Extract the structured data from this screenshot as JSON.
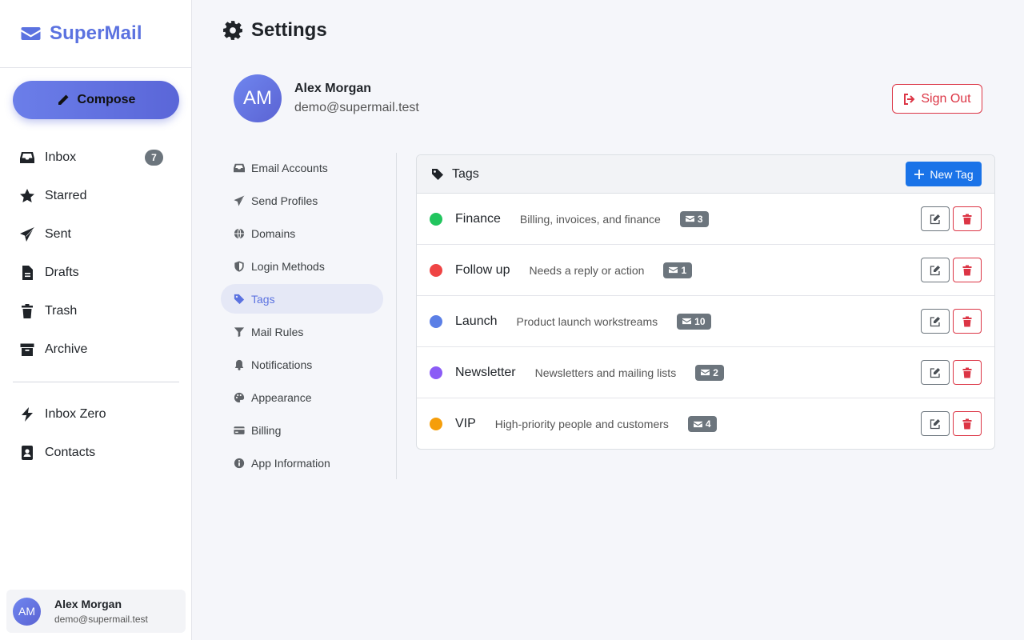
{
  "app": {
    "name": "SuperMail"
  },
  "sidebar": {
    "compose_label": "Compose",
    "nav": [
      {
        "label": "Inbox",
        "icon": "inbox-icon",
        "badge": "7"
      },
      {
        "label": "Starred",
        "icon": "star-icon"
      },
      {
        "label": "Sent",
        "icon": "paper-plane-icon"
      },
      {
        "label": "Drafts",
        "icon": "file-icon"
      },
      {
        "label": "Trash",
        "icon": "trash-icon"
      },
      {
        "label": "Archive",
        "icon": "archive-icon"
      }
    ],
    "nav2": [
      {
        "label": "Inbox Zero",
        "icon": "bolt-icon"
      },
      {
        "label": "Contacts",
        "icon": "address-book-icon"
      }
    ],
    "user": {
      "initials": "AM",
      "name": "Alex Morgan",
      "email": "demo@supermail.test"
    }
  },
  "page": {
    "title": "Settings"
  },
  "profile": {
    "initials": "AM",
    "name": "Alex Morgan",
    "email": "demo@supermail.test",
    "signout_label": "Sign Out"
  },
  "settings_nav": [
    {
      "label": "Email Accounts",
      "icon": "inbox-icon"
    },
    {
      "label": "Send Profiles",
      "icon": "paper-plane-icon"
    },
    {
      "label": "Domains",
      "icon": "globe-icon"
    },
    {
      "label": "Login Methods",
      "icon": "shield-icon"
    },
    {
      "label": "Tags",
      "icon": "tag-icon",
      "active": true
    },
    {
      "label": "Mail Rules",
      "icon": "filter-icon"
    },
    {
      "label": "Notifications",
      "icon": "bell-icon"
    },
    {
      "label": "Appearance",
      "icon": "palette-icon"
    },
    {
      "label": "Billing",
      "icon": "credit-card-icon"
    },
    {
      "label": "App Information",
      "icon": "info-icon"
    }
  ],
  "tags_panel": {
    "title": "Tags",
    "new_tag_label": "New Tag",
    "tags": [
      {
        "name": "Finance",
        "description": "Billing, invoices, and finance",
        "count": "3",
        "color": "#22c55e"
      },
      {
        "name": "Follow up",
        "description": "Needs a reply or action",
        "count": "1",
        "color": "#ef4444"
      },
      {
        "name": "Launch",
        "description": "Product launch workstreams",
        "count": "10",
        "color": "#5b7fe6"
      },
      {
        "name": "Newsletter",
        "description": "Newsletters and mailing lists",
        "count": "2",
        "color": "#8b5cf6"
      },
      {
        "name": "VIP",
        "description": "High-priority people and customers",
        "count": "4",
        "color": "#f59e0b"
      }
    ]
  },
  "colors": {
    "brand": "#5b72e0",
    "primary": "#1a73e8",
    "danger": "#dc3545",
    "badge": "#6c757d"
  }
}
